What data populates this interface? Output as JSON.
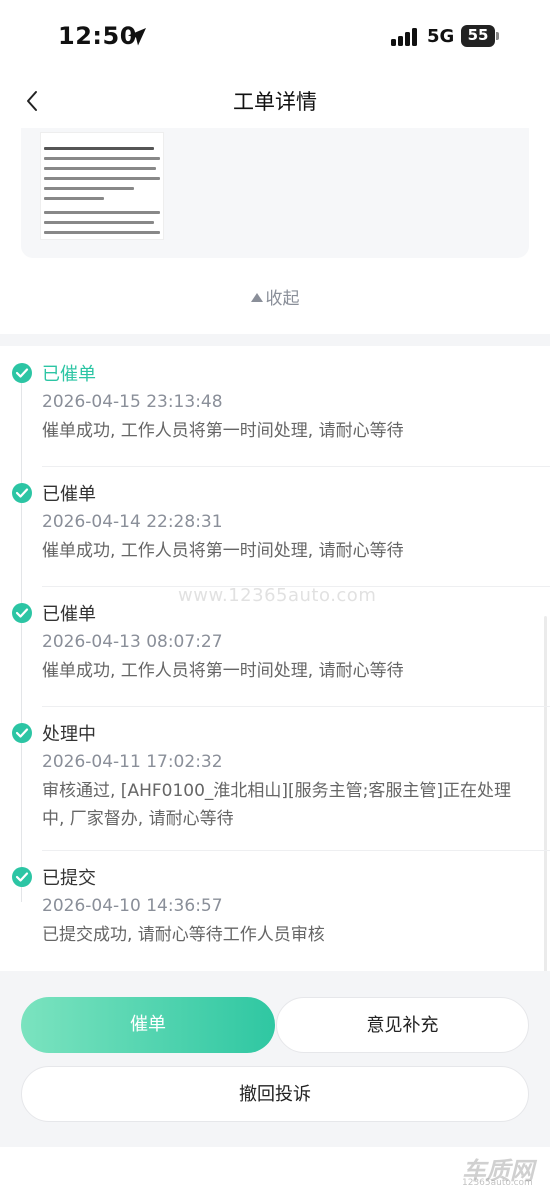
{
  "status_bar": {
    "time": "12:50",
    "network": "5G",
    "battery": "55"
  },
  "nav": {
    "title": "工单详情"
  },
  "attachment": {
    "collapse_label": "收起"
  },
  "timeline": [
    {
      "status": "已催单",
      "time": "2026-04-15 23:13:48",
      "desc": "催单成功, 工作人员将第一时间处理, 请耐心等待",
      "active": true
    },
    {
      "status": "已催单",
      "time": "2026-04-14 22:28:31",
      "desc": "催单成功, 工作人员将第一时间处理, 请耐心等待",
      "active": false
    },
    {
      "status": "已催单",
      "time": "2026-04-13 08:07:27",
      "desc": "催单成功, 工作人员将第一时间处理, 请耐心等待",
      "active": false
    },
    {
      "status": "处理中",
      "time": "2026-04-11 17:02:32",
      "desc": "审核通过, [AHF0100_淮北相山][服务主管;客服主管]正在处理中, 厂家督办, 请耐心等待",
      "active": false
    },
    {
      "status": "已提交",
      "time": "2026-04-10 14:36:57",
      "desc": "已提交成功, 请耐心等待工作人员审核",
      "active": false
    }
  ],
  "watermark": "www.12365auto.com",
  "actions": {
    "urge_label": "催单",
    "supplement_label": "意见补充",
    "revoke_label": "撤回投诉"
  },
  "footer": {
    "logo": "车质网",
    "logo_sub": "12365auto.com"
  },
  "colors": {
    "accent": "#2cc5a4",
    "muted": "#8a8f99"
  }
}
